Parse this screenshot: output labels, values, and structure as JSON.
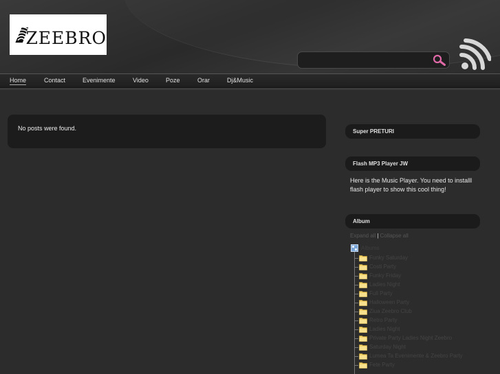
{
  "header": {
    "logo_text": "ZEEBRO",
    "search": {
      "value": "",
      "placeholder": ""
    },
    "search_icon": "magnifier-icon",
    "feed_icon": "rss-feed-icon"
  },
  "nav": {
    "items": [
      {
        "label": "Home",
        "active": true
      },
      {
        "label": "Contact"
      },
      {
        "label": "Evenimente"
      },
      {
        "label": "Video"
      },
      {
        "label": "Poze"
      },
      {
        "label": "Orar"
      },
      {
        "label": "Dj&Music"
      }
    ]
  },
  "main": {
    "message": "No posts were found."
  },
  "sidebar": {
    "widgets": [
      {
        "title": "Super PRETURI"
      },
      {
        "title": "Flash MP3 Player JW",
        "text": "Here is the Music Player. You need to installl flash player to show this cool thing!"
      },
      {
        "title": "Album"
      }
    ],
    "album": {
      "links": [
        "Expand all",
        "Collapse all"
      ],
      "root": "Albums",
      "folders": [
        "Funky Saturday",
        "Costi Party",
        "Funky Friday",
        "Ladies Night",
        "Full Party",
        "Halloween Party",
        "Ziua Zeebro Club",
        "Retro Party",
        "Ladies Night",
        "Private Party Ladies Night Zeebro",
        "Saturday Night",
        "Lumea Ta Evenimente & Zeebro Party",
        "Fete Party"
      ]
    }
  }
}
